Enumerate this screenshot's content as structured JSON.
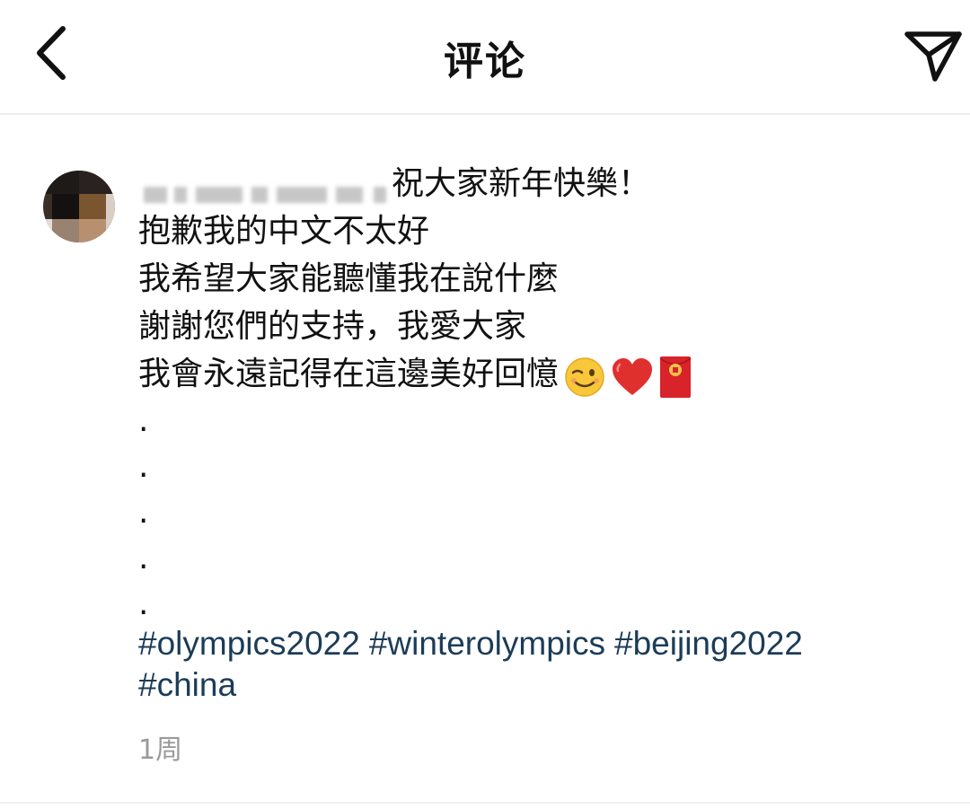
{
  "header": {
    "title": "评论",
    "back_icon": "chevron-left-icon",
    "share_icon": "paper-plane-icon"
  },
  "comment": {
    "lines": [
      "祝大家新年快樂！",
      "抱歉我的中文不太好",
      "我希望大家能聽懂我在說什麼",
      "謝謝您們的支持，我愛大家",
      "我會永遠記得在這邊美好回憶"
    ],
    "emojis": [
      "winking-face-emoji",
      "red-heart-emoji",
      "red-envelope-emoji"
    ],
    "dots": [
      ".",
      ".",
      ".",
      ".",
      "."
    ],
    "hashtags": [
      "#olympics2022",
      "#winterolympics",
      "#beijing2022",
      "#china"
    ],
    "timestamp": "1周"
  },
  "colors": {
    "hashtag": "#1c3c58",
    "timestamp": "#9a9a9a",
    "divider": "#eeeeee",
    "heart": "#e0302e",
    "envelope": "#d9232a"
  }
}
